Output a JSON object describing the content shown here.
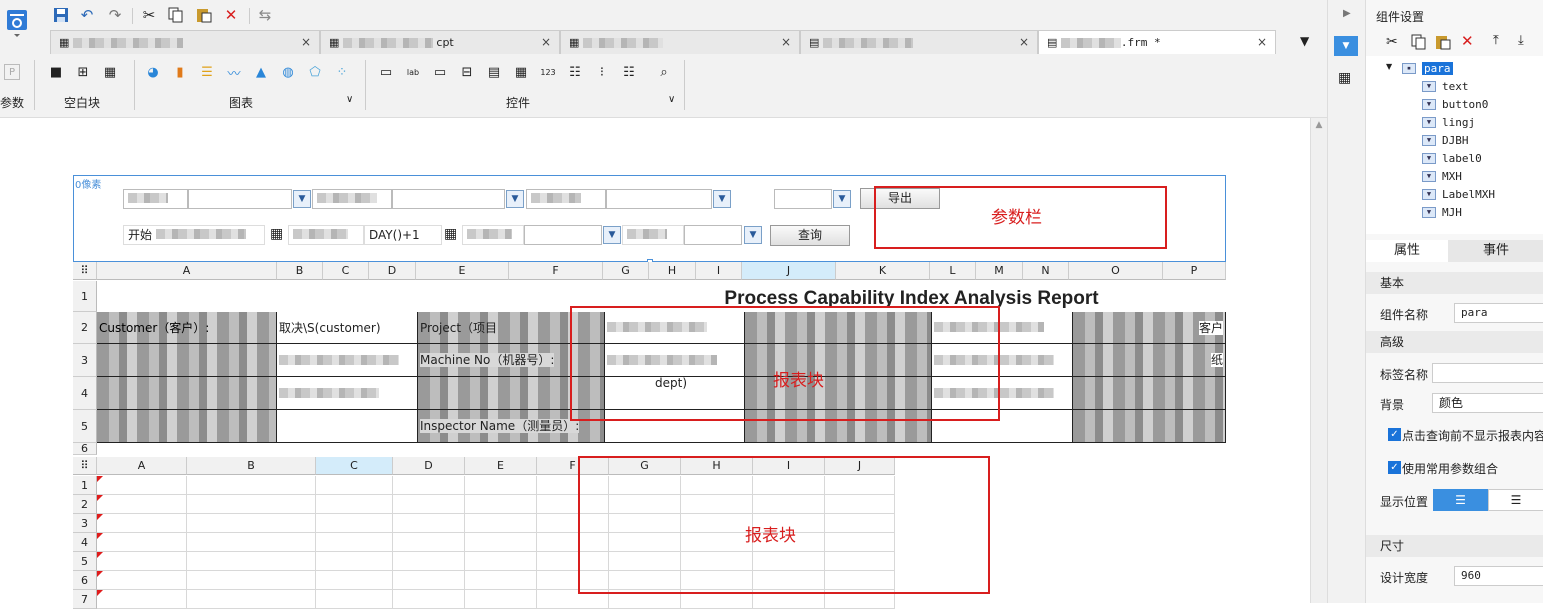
{
  "toolbar": {
    "param_label": "参数",
    "group_blank": "空白块",
    "group_chart": "图表",
    "group_controls": "控件"
  },
  "tabs": [
    {
      "label": "",
      "close": "×"
    },
    {
      "label": "cpt",
      "close": "×"
    },
    {
      "label": "",
      "close": "×"
    },
    {
      "label": "",
      "close": "×"
    },
    {
      "label": ".frm *",
      "close": "×"
    }
  ],
  "parabar": {
    "pixel_label": "0像素",
    "start_label": "开始",
    "today_text": "DAY()+1",
    "export_button": "导出",
    "query_button": "查询",
    "annotation": "参数栏"
  },
  "report": {
    "title": "Process Capability Index Analysis Report",
    "columns1": [
      "A",
      "B",
      "C",
      "D",
      "E",
      "F",
      "G",
      "H",
      "I",
      "J",
      "K",
      "L",
      "M",
      "N",
      "O",
      "P"
    ],
    "columns2": [
      "A",
      "B",
      "C",
      "D",
      "E",
      "F",
      "G",
      "H",
      "I",
      "J"
    ],
    "rows1": [
      "1",
      "2",
      "3",
      "4",
      "5",
      "6"
    ],
    "rows2": [
      "1",
      "2",
      "3",
      "4",
      "5",
      "6",
      "7"
    ],
    "cell_customer": "Customer（客户）:",
    "cell_customer_field": "取决\\S(customer)",
    "cell_project": "Project（项目",
    "cell_machine": "Machine No（机器号）:",
    "cell_inspector": "Inspector Name（测量员）:",
    "cell_dept": "dept)",
    "cell_customer_right": "客户",
    "cell_paper_right": "纸",
    "annotation1": "报表块",
    "annotation2": "报表块"
  },
  "panel": {
    "title": "组件设置",
    "tree_root": "para",
    "tree_items": [
      "text",
      "button0",
      "lingj",
      "DJBH",
      "label0",
      "MXH",
      "LabelMXH",
      "MJH"
    ],
    "tab_properties": "属性",
    "tab_events": "事件",
    "section_basic": "基本",
    "component_name_label": "组件名称",
    "component_name_value": "para",
    "section_advanced": "高级",
    "tag_name_label": "标签名称",
    "background_label": "背景",
    "background_value": "颜色",
    "check1": "点击查询前不显示报表内容",
    "check2": "使用常用参数组合",
    "display_pos_label": "显示位置",
    "section_size": "尺寸",
    "design_width_label": "设计宽度",
    "design_width_value": "960"
  },
  "colors": {
    "accent": "#1a73d9",
    "annotation_red": "#d81e1e",
    "param_border": "#4a90d9"
  }
}
